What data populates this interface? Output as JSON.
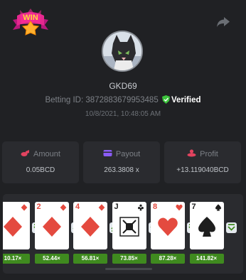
{
  "badge": {
    "text": "WIN"
  },
  "profile": {
    "username": "GKD69",
    "betting_id_label": "Betting ID:",
    "betting_id": "3872883679953485",
    "verified_label": "Verified",
    "date": "10/8/2021, 10:48:05 AM"
  },
  "stats": {
    "amount": {
      "label": "Amount",
      "value": "0.05BCD",
      "icon": "coins-icon",
      "color": "#e2435f"
    },
    "payout": {
      "label": "Payout",
      "value": "263.3808 x",
      "icon": "wallet-icon",
      "color": "#8a5cf6"
    },
    "profit": {
      "label": "Profit",
      "value": "+13.119040BCD",
      "icon": "coin-stack-icon",
      "color": "#e2435f"
    }
  },
  "colors": {
    "verified": "#3cc43c",
    "multiplier_bg": "#3f8a1f",
    "card_red": "#e44a3f"
  },
  "cards": [
    {
      "rank": "",
      "suit": "diamond",
      "color": "red",
      "multiplier": "10.17×",
      "next_arrow": "lower"
    },
    {
      "rank": "2",
      "suit": "diamond",
      "color": "red",
      "multiplier": "52.44×",
      "next_arrow": "higher"
    },
    {
      "rank": "4",
      "suit": "diamond",
      "color": "red",
      "multiplier": "56.81×",
      "next_arrow": "higher"
    },
    {
      "rank": "J",
      "suit": "club",
      "color": "black",
      "multiplier": "73.85×",
      "next_arrow": "lower"
    },
    {
      "rank": "8",
      "suit": "heart",
      "color": "red",
      "multiplier": "87.28×",
      "next_arrow": "lower"
    },
    {
      "rank": "7",
      "suit": "spade",
      "color": "black",
      "multiplier": "141.82×",
      "next_arrow": "lower"
    }
  ]
}
